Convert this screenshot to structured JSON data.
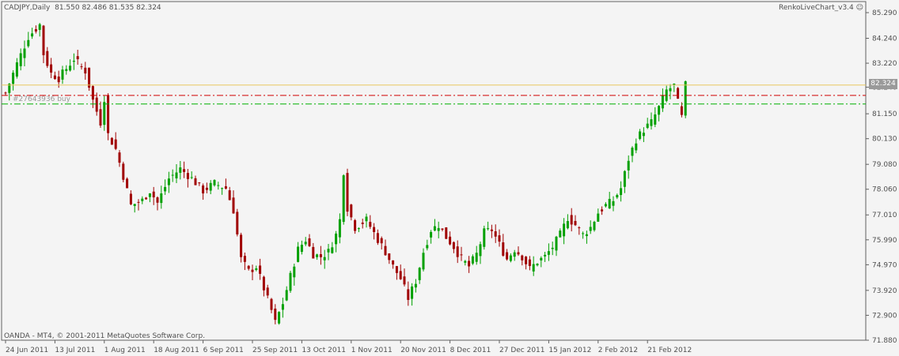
{
  "header": {
    "title": "CADJPY,Daily  81.550 82.486 81.535 82.324"
  },
  "indicator_label": "RenkoLiveChart_v3.4 ☺",
  "copyright": "OANDA - MT4, © 2001-2011 MetaQuotes Software Corp.",
  "order_label": "#27643936 buy",
  "current_price_label": "82.324",
  "colors": {
    "background": "#f4f4f4",
    "bull": "#00a000",
    "bear": "#a00000",
    "current_line": "#e8c860",
    "tp_line": "#d00000",
    "sl_line": "#00b000",
    "axis": "#606060"
  },
  "chart_data": {
    "type": "candlestick",
    "symbol": "CADJPY",
    "timeframe": "Daily",
    "ohlc_header": {
      "open": 81.55,
      "high": 82.486,
      "low": 81.535,
      "close": 82.324
    },
    "ylim": [
      71.88,
      85.29
    ],
    "y_ticks": [
      "85.290",
      "84.240",
      "83.220",
      "82.240",
      "81.150",
      "80.130",
      "79.080",
      "78.060",
      "77.010",
      "75.990",
      "74.970",
      "73.920",
      "72.900",
      "71.880"
    ],
    "x_ticks": [
      {
        "label": "24 Jun 2011",
        "i": 0
      },
      {
        "label": "13 Jul 2011",
        "i": 13
      },
      {
        "label": "1 Aug 2011",
        "i": 26
      },
      {
        "label": "18 Aug 2011",
        "i": 39
      },
      {
        "label": "6 Sep 2011",
        "i": 52
      },
      {
        "label": "25 Sep 2011",
        "i": 65
      },
      {
        "label": "13 Oct 2011",
        "i": 78
      },
      {
        "label": "1 Nov 2011",
        "i": 91
      },
      {
        "label": "20 Nov 2011",
        "i": 104
      },
      {
        "label": "8 Dec 2011",
        "i": 117
      },
      {
        "label": "27 Dec 2011",
        "i": 130
      },
      {
        "label": "15 Jan 2012",
        "i": 143
      },
      {
        "label": "2 Feb 2012",
        "i": 156
      },
      {
        "label": "21 Feb 2012",
        "i": 169
      }
    ],
    "candle_count": 179,
    "close_anchors": [
      [
        0,
        82.0
      ],
      [
        3,
        83.2
      ],
      [
        6,
        84.3
      ],
      [
        9,
        84.8
      ],
      [
        10,
        83.6
      ],
      [
        12,
        82.8
      ],
      [
        14,
        82.6
      ],
      [
        18,
        83.4
      ],
      [
        21,
        82.9
      ],
      [
        23,
        81.7
      ],
      [
        25,
        80.8
      ],
      [
        26,
        81.8
      ],
      [
        27,
        80.3
      ],
      [
        29,
        79.7
      ],
      [
        31,
        78.6
      ],
      [
        33,
        77.4
      ],
      [
        36,
        77.6
      ],
      [
        38,
        78.0
      ],
      [
        40,
        77.5
      ],
      [
        43,
        78.5
      ],
      [
        46,
        78.9
      ],
      [
        49,
        78.5
      ],
      [
        52,
        78.0
      ],
      [
        55,
        78.3
      ],
      [
        58,
        78.1
      ],
      [
        60,
        77.2
      ],
      [
        61,
        76.2
      ],
      [
        62,
        75.2
      ],
      [
        64,
        74.7
      ],
      [
        66,
        74.9
      ],
      [
        68,
        74.0
      ],
      [
        70,
        73.1
      ],
      [
        71,
        72.6
      ],
      [
        73,
        73.4
      ],
      [
        75,
        74.5
      ],
      [
        77,
        75.6
      ],
      [
        79,
        76.0
      ],
      [
        81,
        75.4
      ],
      [
        83,
        75.3
      ],
      [
        85,
        75.5
      ],
      [
        87,
        76.2
      ],
      [
        88,
        76.8
      ],
      [
        89,
        78.8
      ],
      [
        90,
        77.3
      ],
      [
        92,
        76.5
      ],
      [
        95,
        76.8
      ],
      [
        98,
        76.0
      ],
      [
        100,
        75.5
      ],
      [
        102,
        74.9
      ],
      [
        104,
        74.4
      ],
      [
        106,
        73.6
      ],
      [
        108,
        74.3
      ],
      [
        110,
        75.5
      ],
      [
        112,
        76.4
      ],
      [
        114,
        76.6
      ],
      [
        116,
        76.1
      ],
      [
        118,
        75.7
      ],
      [
        120,
        75.2
      ],
      [
        122,
        74.9
      ],
      [
        124,
        75.4
      ],
      [
        126,
        76.3
      ],
      [
        128,
        76.4
      ],
      [
        130,
        75.8
      ],
      [
        132,
        75.2
      ],
      [
        134,
        75.6
      ],
      [
        136,
        75.3
      ],
      [
        138,
        74.8
      ],
      [
        140,
        75.1
      ],
      [
        142,
        75.3
      ],
      [
        144,
        75.7
      ],
      [
        146,
        76.2
      ],
      [
        148,
        76.9
      ],
      [
        150,
        76.6
      ],
      [
        152,
        76.2
      ],
      [
        154,
        76.5
      ],
      [
        156,
        77.1
      ],
      [
        158,
        77.4
      ],
      [
        160,
        77.6
      ],
      [
        162,
        78.1
      ],
      [
        164,
        79.3
      ],
      [
        166,
        80.1
      ],
      [
        168,
        80.5
      ],
      [
        170,
        80.8
      ],
      [
        172,
        81.4
      ],
      [
        174,
        82.1
      ],
      [
        176,
        82.3
      ],
      [
        177,
        81.6
      ],
      [
        178,
        81.0
      ],
      [
        179,
        82.32
      ]
    ],
    "horizontal_lines": [
      {
        "name": "current-price",
        "value": 82.324,
        "style": "solid"
      },
      {
        "name": "take-profit",
        "value": 81.9,
        "style": "dash-dot"
      },
      {
        "name": "stop-loss",
        "value": 81.55,
        "style": "dash-dot"
      }
    ]
  }
}
